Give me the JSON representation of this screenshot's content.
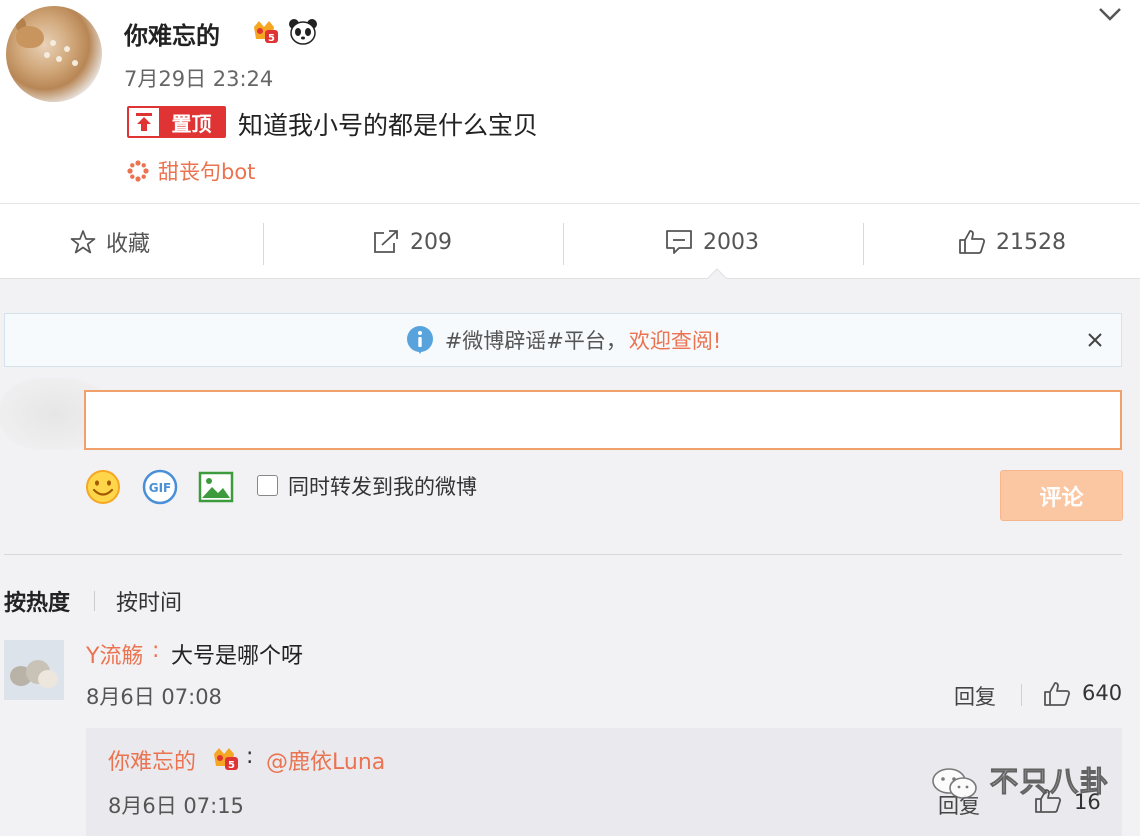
{
  "post": {
    "username": "你难忘的",
    "time": "7月29日 23:24",
    "pin_label": "置顶",
    "text": "知道我小号的都是什么宝贝",
    "source": "甜丧句bot"
  },
  "actions": {
    "favorite": "收藏",
    "repost": "209",
    "comment": "2003",
    "like": "21528"
  },
  "notice": {
    "text": "#微博辟谣#平台，",
    "highlight": "欢迎查阅!"
  },
  "composer": {
    "input_value": "",
    "repost_label": "同时转发到我的微博",
    "submit_label": "评论"
  },
  "sort": {
    "hot": "按热度",
    "time": "按时间"
  },
  "comment": {
    "name": "Y流觞",
    "colon": ":",
    "text": "大号是哪个呀",
    "time": "8月6日 07:08",
    "reply": "回复",
    "likes": "640"
  },
  "sub_reply": {
    "name": "你难忘的",
    "colon": ":",
    "mention": "@鹿依Luna",
    "time": "8月6日 07:15",
    "reply": "回复",
    "likes": "16"
  },
  "watermark": "不只八卦",
  "colors": {
    "accent": "#eb7350",
    "pin_red": "#e03434",
    "button_disabled": "#fbc7a3",
    "notice_icon": "#59a3dd"
  }
}
